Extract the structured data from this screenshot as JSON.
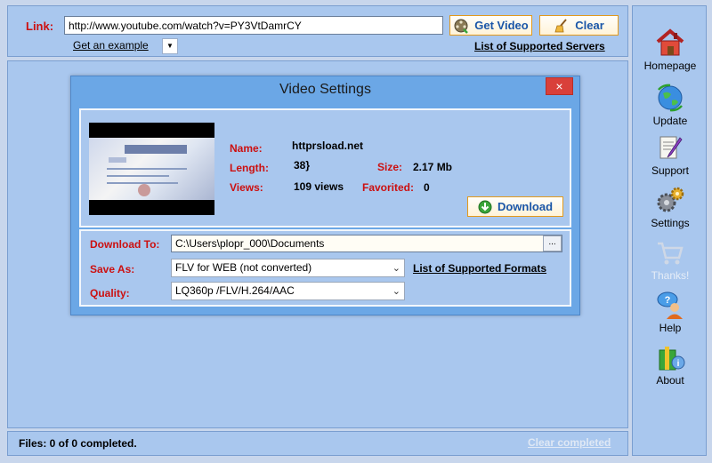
{
  "top": {
    "link_label": "Link:",
    "link_value": "http://www.youtube.com/watch?v=PY3VtDamrCY",
    "get_video_label": "Get Video",
    "clear_label": "Clear",
    "example_label": "Get an example",
    "servers_label": "List of Supported Servers"
  },
  "dialog": {
    "title": "Video Settings",
    "close": "×",
    "info": {
      "name_label": "Name:",
      "name_value": "httprsload.net",
      "length_label": "Length:",
      "length_value": "38}",
      "views_label": "Views:",
      "views_value": "109 views",
      "size_label": "Size:",
      "size_value": "2.17 Mb",
      "favorited_label": "Favorited:",
      "favorited_value": "0",
      "download_label": "Download"
    },
    "settings": {
      "download_to_label": "Download To:",
      "download_to_value": "C:\\Users\\plopr_000\\Documents",
      "browse_label": "...",
      "save_as_label": "Save As:",
      "save_as_value": "FLV for WEB (not converted)",
      "formats_label": "List of Supported Formats",
      "quality_label": "Quality:",
      "quality_value": "LQ360p /FLV/H.264/AAC"
    }
  },
  "status": {
    "files": "Files: 0 of 0 completed.",
    "clear_completed": "Clear completed"
  },
  "sidebar": {
    "items": [
      {
        "label": "Homepage",
        "icon": "home-icon"
      },
      {
        "label": "Update",
        "icon": "globe-icon"
      },
      {
        "label": "Support",
        "icon": "document-pen-icon"
      },
      {
        "label": "Settings",
        "icon": "gears-icon"
      },
      {
        "label": "Thanks!",
        "icon": "cart-icon"
      },
      {
        "label": "Help",
        "icon": "help-person-icon"
      },
      {
        "label": "About",
        "icon": "box-icon"
      }
    ]
  },
  "colors": {
    "panel": "#a9c7ee",
    "dialog": "#6ba7e6",
    "label_red": "#cc1010",
    "link_blue": "#1a56a8",
    "close_red": "#d9403a"
  }
}
